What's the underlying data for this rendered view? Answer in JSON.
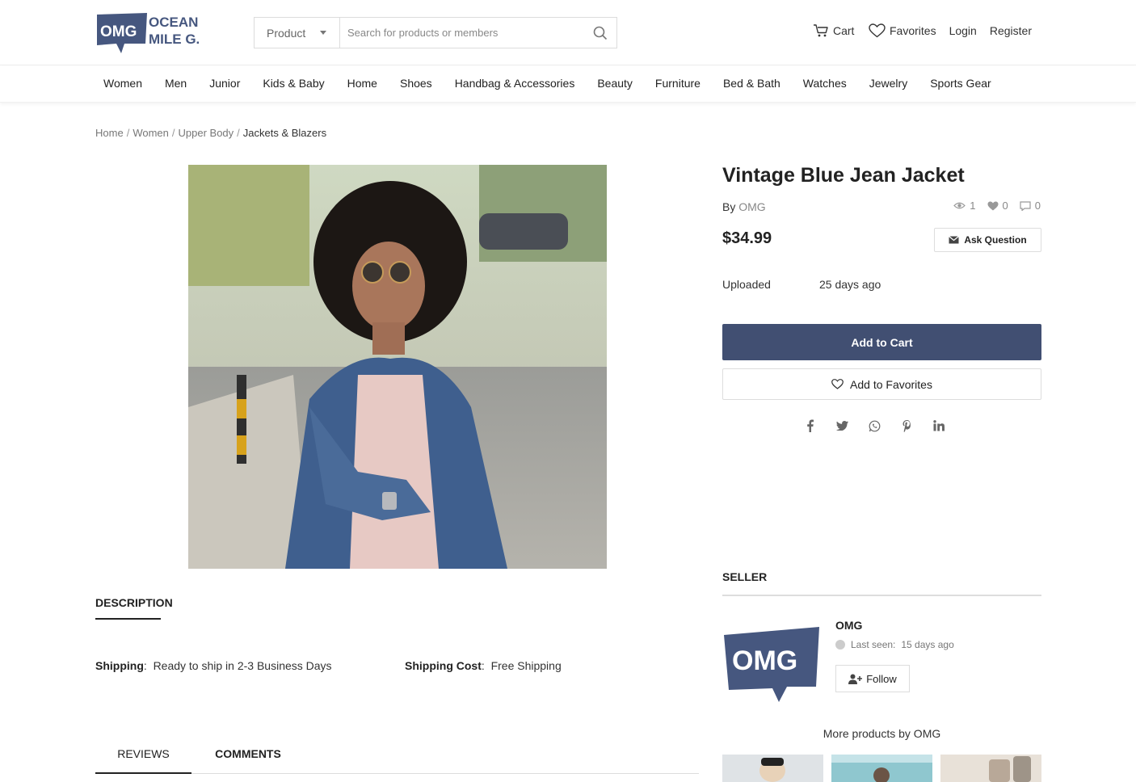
{
  "header": {
    "logo_text_main": "OMG",
    "logo_text_top": "OCEAN",
    "logo_text_bottom": "MILE G.",
    "search_category": "Product",
    "search_placeholder": "Search for products or members",
    "cart_label": "Cart",
    "favorites_label": "Favorites",
    "login_label": "Login",
    "register_label": "Register"
  },
  "categories": [
    "Women",
    "Men",
    "Junior",
    "Kids & Baby",
    "Home",
    "Shoes",
    "Handbag & Accessories",
    "Beauty",
    "Furniture",
    "Bed & Bath",
    "Watches",
    "Jewelry",
    "Sports Gear"
  ],
  "breadcrumb": [
    "Home",
    "Women",
    "Upper Body",
    "Jackets & Blazers"
  ],
  "product": {
    "title": "Vintage Blue Jean Jacket",
    "by_label": "By",
    "seller": "OMG",
    "views": "1",
    "likes": "0",
    "comments": "0",
    "price": "$34.99",
    "ask_label": "Ask Question",
    "uploaded_label": "Uploaded",
    "uploaded_value": "25 days ago",
    "add_to_cart": "Add to Cart",
    "add_to_favorites": "Add to Favorites"
  },
  "seller_section": {
    "heading": "SELLER",
    "name": "OMG",
    "logo_text": "OMG",
    "last_seen_label": "Last seen:",
    "last_seen_value": "15 days ago",
    "follow_label": "Follow",
    "more_label": "More products by OMG"
  },
  "description": {
    "heading": "DESCRIPTION",
    "shipping_label": "Shipping",
    "shipping_value": "Ready to ship in 2-3 Business Days",
    "shipping_cost_label": "Shipping Cost",
    "shipping_cost_value": "Free Shipping"
  },
  "tabs": [
    "REVIEWS",
    "COMMENTS"
  ],
  "colors": {
    "brand": "#414f72",
    "primary_button": "#414f72"
  }
}
